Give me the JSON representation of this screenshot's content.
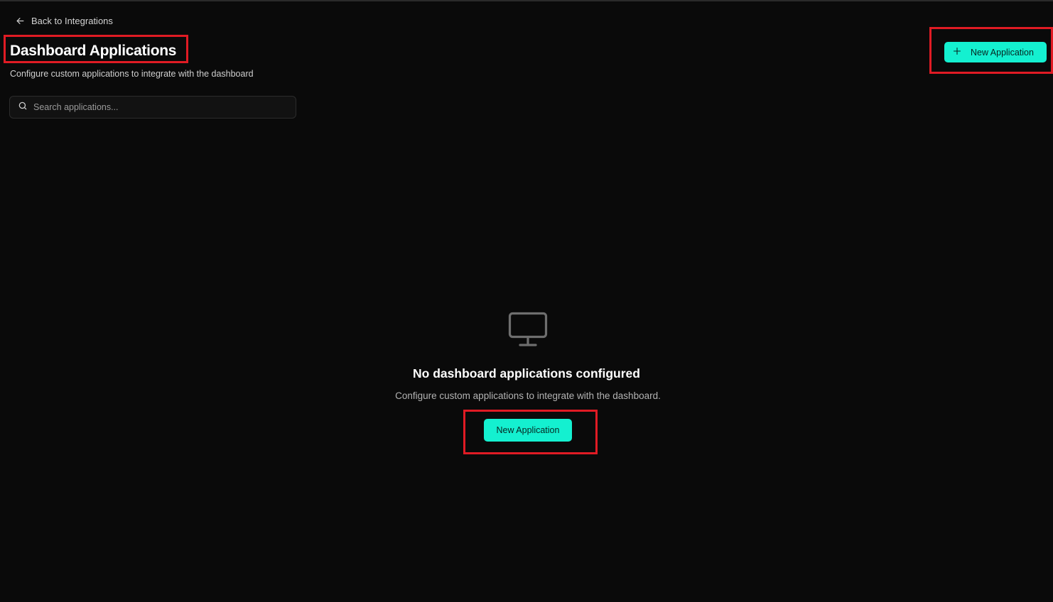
{
  "nav": {
    "back_label": "Back to Integrations",
    "back_icon": "arrow-left-icon"
  },
  "header": {
    "title": "Dashboard Applications",
    "subtitle": "Configure custom applications to integrate with the dashboard",
    "new_button_label": "New Application",
    "new_button_icon": "plus-icon"
  },
  "search": {
    "placeholder": "Search applications...",
    "value": "",
    "icon": "search-icon"
  },
  "empty_state": {
    "icon": "monitor-icon",
    "title": "No dashboard applications configured",
    "description": "Configure custom applications to integrate with the dashboard.",
    "button_label": "New Application"
  },
  "colors": {
    "background": "#0a0a0a",
    "accent": "#14f0d0",
    "highlight_box": "#e01b24",
    "text_primary": "#ffffff",
    "text_muted": "#b3b3b3"
  }
}
